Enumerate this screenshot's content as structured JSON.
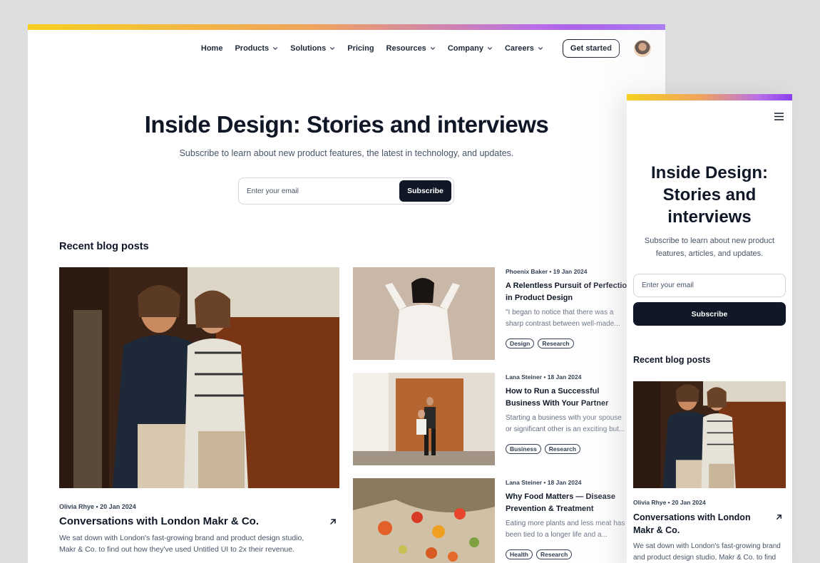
{
  "nav": {
    "items": [
      {
        "label": "Home",
        "dropdown": false
      },
      {
        "label": "Products",
        "dropdown": true
      },
      {
        "label": "Solutions",
        "dropdown": true
      },
      {
        "label": "Pricing",
        "dropdown": false
      },
      {
        "label": "Resources",
        "dropdown": true
      },
      {
        "label": "Company",
        "dropdown": true
      },
      {
        "label": "Careers",
        "dropdown": true
      }
    ],
    "cta": "Get started"
  },
  "hero": {
    "title": "Inside Design: Stories and interviews",
    "subtitle": "Subscribe to learn about new product features, the latest in technology, and updates.",
    "email_placeholder": "Enter your email",
    "subscribe_label": "Subscribe"
  },
  "blog": {
    "heading": "Recent blog posts",
    "featured": {
      "meta": "Olivia Rhye • 20 Jan 2024",
      "title": "Conversations with London Makr & Co.",
      "description": "We sat down with London's fast-growing brand and product design studio, Makr & Co. to find out how they've used Untitled UI to 2x their revenue."
    },
    "posts": [
      {
        "meta": "Phoenix Baker • 19 Jan 2024",
        "title_line1": "A Relentless Pursuit of Perfection",
        "title_line2": "in Product Design",
        "description": "\"I began to notice that there was a sharp contrast between well-made...",
        "tags": [
          "Design",
          "Research"
        ]
      },
      {
        "meta": "Lana Steiner • 18 Jan 2024",
        "title_line1": "How to Run a Successful",
        "title_line2": "Business With Your Partner",
        "description": "Starting a business with your spouse or significant other is an exciting but...",
        "tags": [
          "Business",
          "Research"
        ]
      },
      {
        "meta": "Lana Steiner • 18 Jan 2024",
        "title_line1": "Why Food Matters — Disease",
        "title_line2": "Prevention & Treatment",
        "description": "Eating more plants and less meat has been tied to a longer life and a...",
        "tags": [
          "Health",
          "Research"
        ]
      }
    ]
  },
  "mobile": {
    "title": "Inside Design: Stories and interviews",
    "subtitle": "Subscribe to learn about new product features, articles, and updates.",
    "email_placeholder": "Enter your email",
    "subscribe_label": "Subscribe",
    "recent_heading": "Recent blog posts",
    "featured_meta": "Olivia Rhye • 20 Jan 2024",
    "featured_title": "Conversations with London Makr & Co.",
    "featured_description": "We sat down with London's fast-growing brand and product design studio, Makr & Co. to find"
  },
  "icons": {
    "nav_chevron": "chevron-down-icon",
    "arrow": "arrow-up-right-icon",
    "menu": "hamburger-menu-icon"
  },
  "colors": {
    "primary_dark": "#101828",
    "gradient_start": "#f5d020",
    "gradient_end": "#8a3ff0"
  }
}
